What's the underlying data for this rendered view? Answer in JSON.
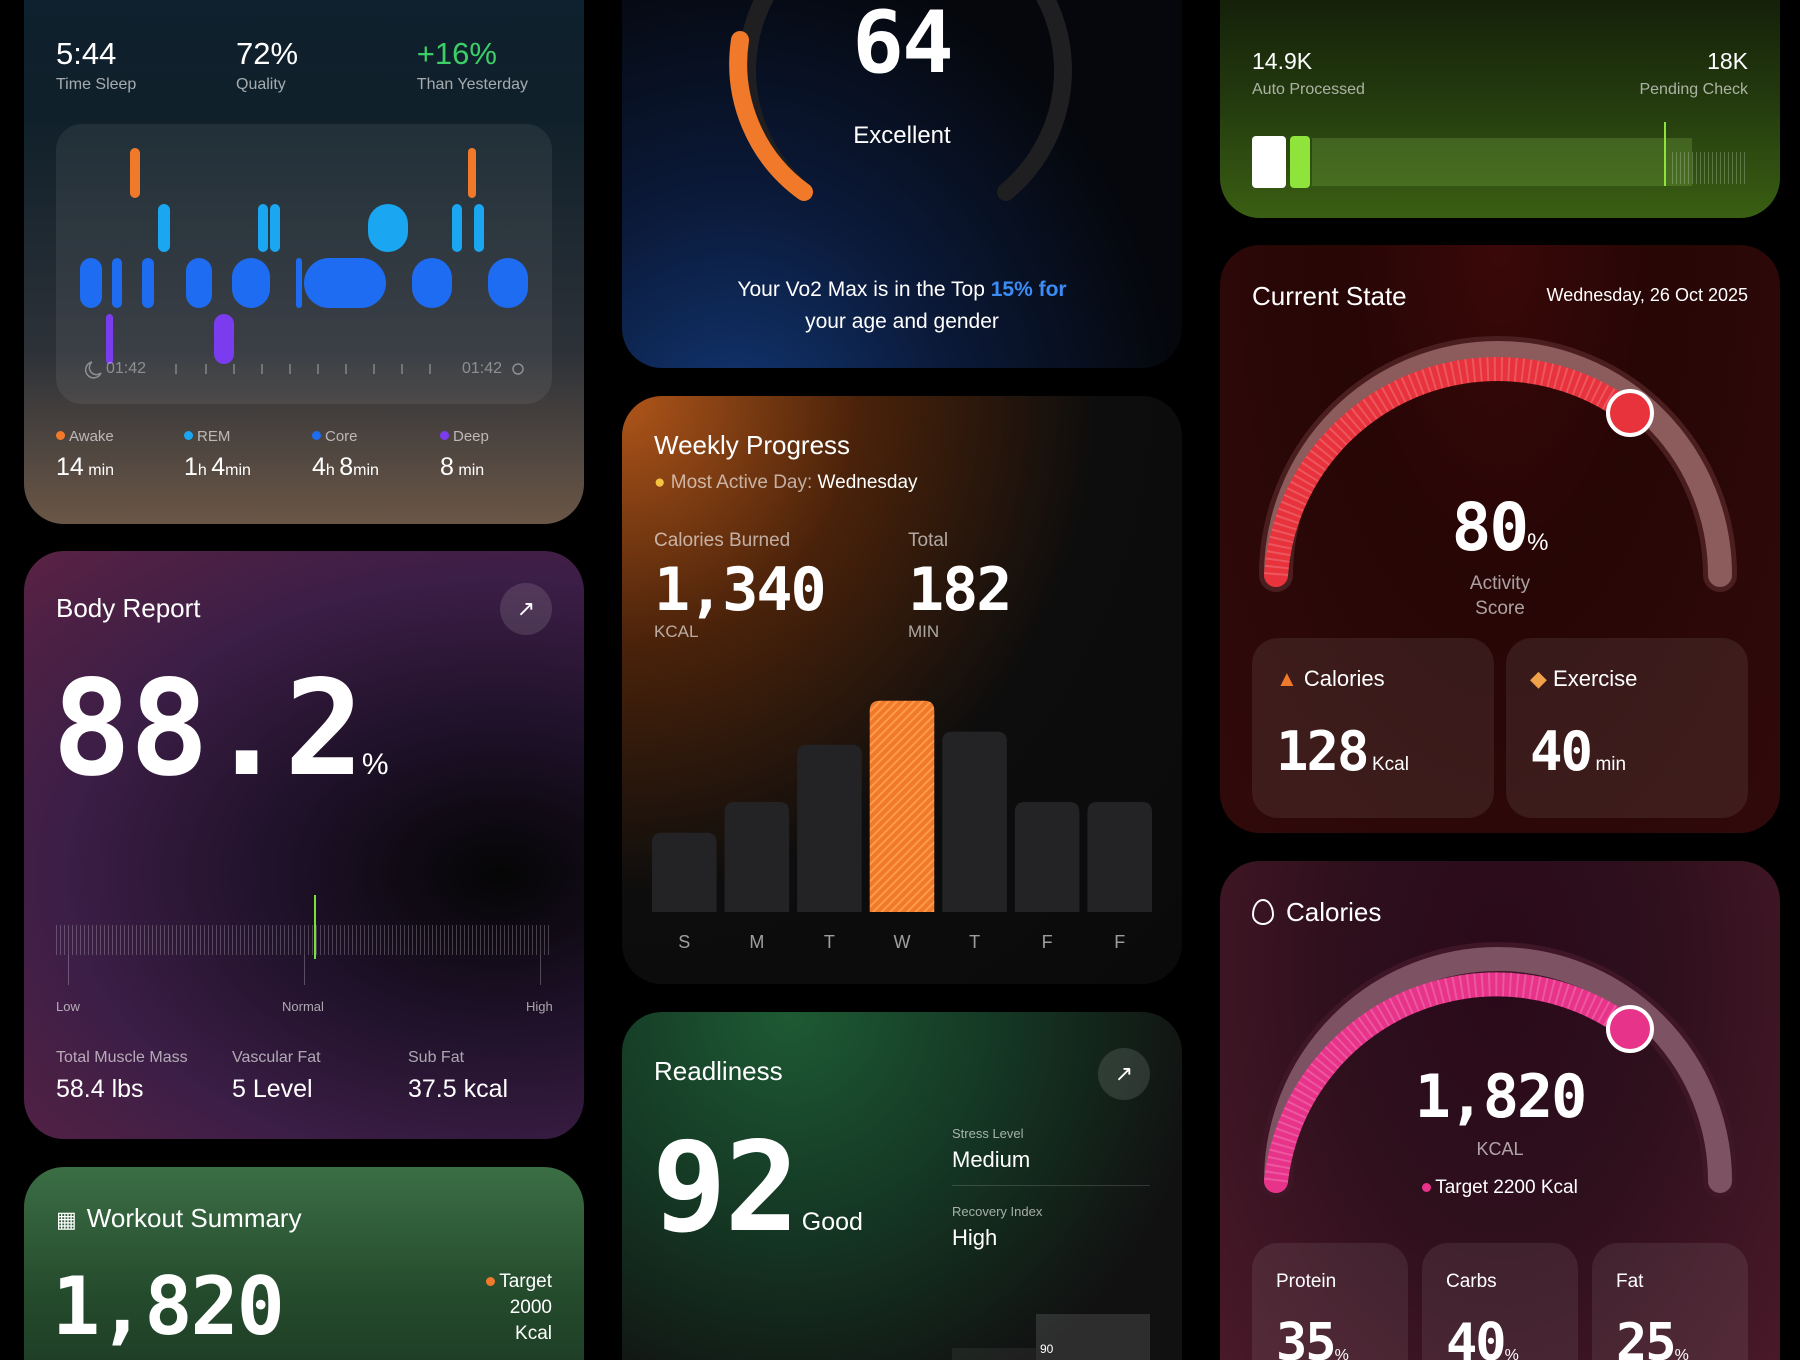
{
  "sleep": {
    "stats": [
      {
        "value": "5:44",
        "label": "Time Sleep"
      },
      {
        "value": "72%",
        "label": "Quality"
      },
      {
        "value": "+16%",
        "label": "Than Yesterday"
      }
    ],
    "start_time": "01:42",
    "end_time": "01:42",
    "legend": [
      {
        "label": "Awake",
        "value": "14",
        "unit": "min",
        "color": "#f07a2a"
      },
      {
        "label": "REM",
        "value1": "1",
        "unit1": "h",
        "value2": "4",
        "unit2": "min",
        "color": "#1aa6f0"
      },
      {
        "label": "Core",
        "value1": "4",
        "unit1": "h",
        "value2": "8",
        "unit2": "min",
        "color": "#1e6cf2"
      },
      {
        "label": "Deep",
        "value": "8",
        "unit": "min",
        "color": "#7b3cf0"
      }
    ]
  },
  "vo2": {
    "score": "64",
    "rating": "Excellent",
    "text_line1_a": "Your Vo2 Max is in the Top ",
    "text_highlight": "15% for",
    "text_line2": "your age and gender",
    "accent": "#f07a2a"
  },
  "processing": {
    "left_value": "14.9K",
    "left_label": "Auto Processed",
    "right_value": "18K",
    "right_label": "Pending Check"
  },
  "current_state": {
    "title": "Current State",
    "date": "Wednesday, 26 Oct 2025",
    "score": "80",
    "score_unit": "%",
    "score_label_1": "Activity",
    "score_label_2": "Score",
    "score_fraction": 0.8,
    "calories_label": "Calories",
    "calories_value": "128",
    "calories_unit": "Kcal",
    "exercise_label": "Exercise",
    "exercise_value": "40",
    "exercise_unit": "min",
    "accent": "#e8323c"
  },
  "body_report": {
    "title": "Body Report",
    "value": "88.2",
    "unit": "%",
    "scale_low": "Low",
    "scale_normal": "Normal",
    "scale_high": "High",
    "metrics": [
      {
        "label": "Total Muscle Mass",
        "value": "58.4 lbs"
      },
      {
        "label": "Vascular Fat",
        "value": "5 Level"
      },
      {
        "label": "Sub Fat",
        "value": "37.5 kcal"
      }
    ]
  },
  "weekly": {
    "title": "Weekly Progress",
    "subtitle_label": "Most Active Day:",
    "subtitle_value": "Wednesday",
    "calories_label": "Calories Burned",
    "calories_value": "1,340",
    "calories_unit": "KCAL",
    "total_label": "Total",
    "total_value": "182",
    "total_unit": "MIN",
    "accent": "#f07a2a"
  },
  "chart_data": {
    "type": "bar",
    "categories": [
      "S",
      "M",
      "T",
      "W",
      "T",
      "F",
      "F"
    ],
    "values": [
      36,
      50,
      76,
      96,
      82,
      50,
      50
    ],
    "ylim": [
      0,
      100
    ],
    "highlight_index": 3
  },
  "readiness": {
    "title": "Readliness",
    "score": "92",
    "rating": "Good",
    "stress_label": "Stress Level",
    "stress_value": "Medium",
    "recovery_label": "Recovery Index",
    "recovery_value": "High",
    "mini_value": "90"
  },
  "calories_card": {
    "title": "Calories",
    "value": "1,820",
    "unit": "KCAL",
    "target": "Target 2200 Kcal",
    "fraction": 0.8,
    "accent": "#e8338a",
    "macros": [
      {
        "label": "Protein",
        "value": "35"
      },
      {
        "label": "Carbs",
        "value": "40"
      },
      {
        "label": "Fat",
        "value": "25"
      }
    ],
    "macro_unit": "%"
  },
  "workout": {
    "title": "Workout Summary",
    "value": "1,820",
    "target_label": "Target",
    "target_value": "2000",
    "target_unit": "Kcal"
  }
}
